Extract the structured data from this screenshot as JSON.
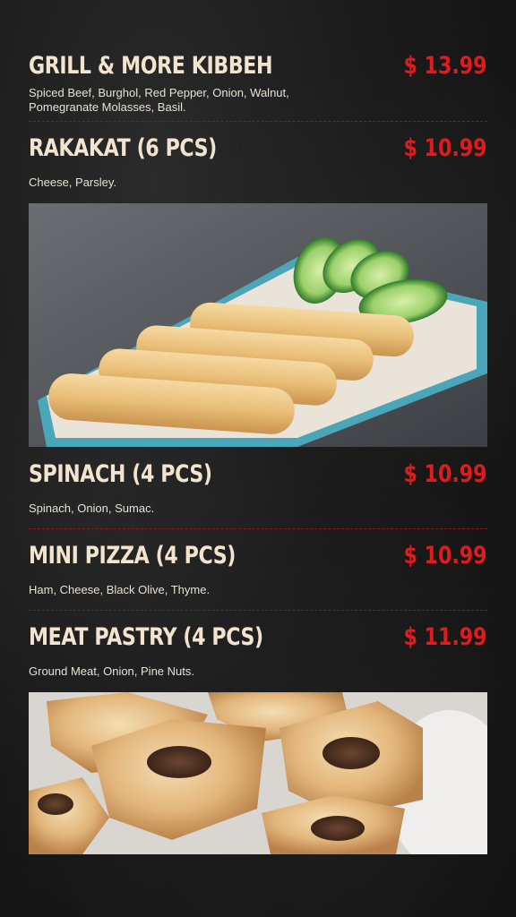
{
  "menu": {
    "items": [
      {
        "name": "GRILL & MORE KIBBEH",
        "price": "$ 13.99",
        "description": "Spiced Beef, Burghol, Red Pepper, Onion, Walnut, Pomegranate Molasses, Basil."
      },
      {
        "name": "RAKAKAT (6 PCS)",
        "price": "$ 10.99",
        "description": "Cheese, Parsley."
      },
      {
        "name": "SPINACH (4 PCS)",
        "price": "$ 10.99",
        "description": "Spinach, Onion, Sumac."
      },
      {
        "name": "MINI PIZZA (4 PCS)",
        "price": "$ 10.99",
        "description": "Ham, Cheese, Black Olive, Thyme."
      },
      {
        "name": "MEAT PASTRY (4 PCS)",
        "price": "$ 11.99",
        "description": "Ground Meat, Onion, Pine Nuts."
      }
    ],
    "colors": {
      "background": "#1a1a1a",
      "name_text": "#f3e4cf",
      "price_text": "#e01b1b",
      "divider": "#8a1a1a"
    },
    "images": [
      {
        "icon": "rakakat-photo"
      },
      {
        "icon": "meat-pastry-photo"
      }
    ]
  }
}
